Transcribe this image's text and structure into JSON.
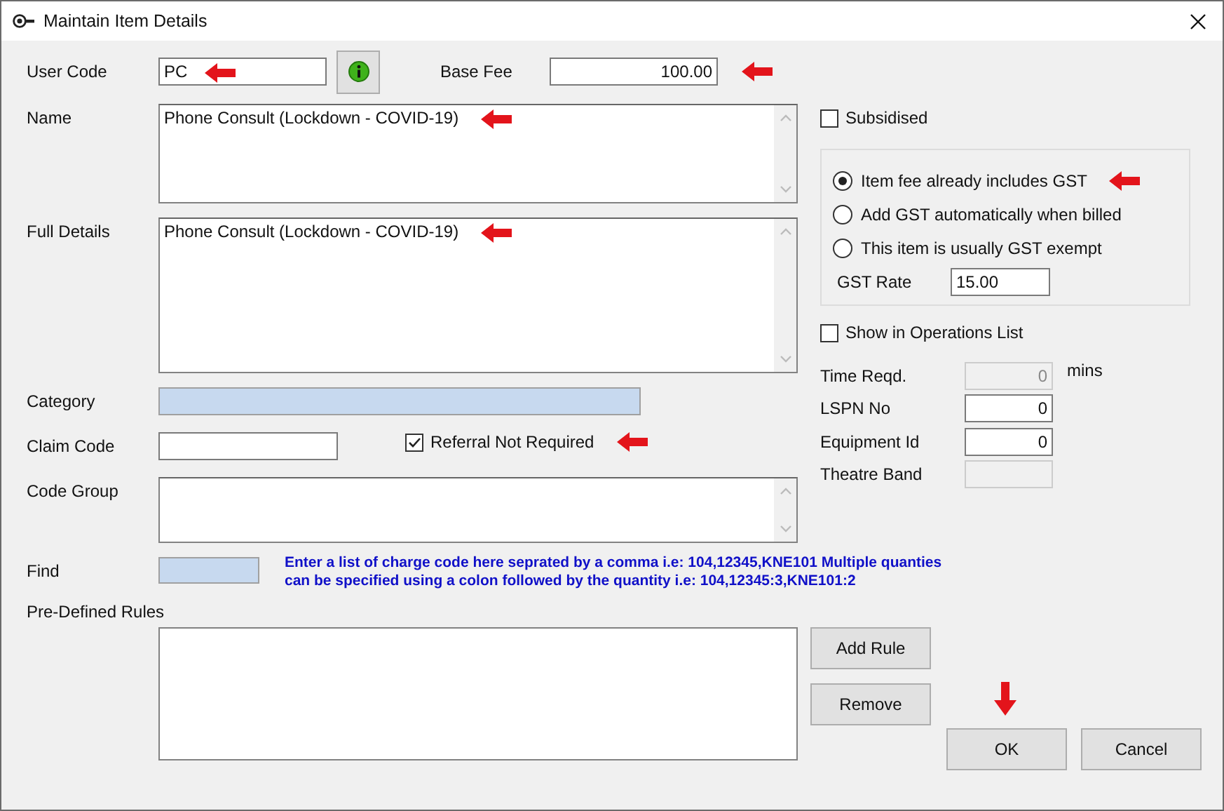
{
  "window": {
    "title": "Maintain Item Details"
  },
  "user_code": {
    "label": "User Code",
    "value": "PC"
  },
  "base_fee": {
    "label": "Base Fee",
    "value": "100.00"
  },
  "name": {
    "label": "Name",
    "value": "Phone Consult (Lockdown - COVID-19)"
  },
  "full_details": {
    "label": "Full Details",
    "value": "Phone Consult (Lockdown - COVID-19)"
  },
  "category": {
    "label": "Category"
  },
  "claim_code": {
    "label": "Claim Code"
  },
  "referral": {
    "label": "Referral Not Required",
    "checked": true
  },
  "code_group": {
    "label": "Code Group"
  },
  "find": {
    "label": "Find",
    "hint": "Enter a list of charge code here seprated by a comma i.e: 104,12345,KNE101 Multiple quanties can be specified using a colon followed by the quantity i.e: 104,12345:3,KNE101:2"
  },
  "rules": {
    "label": "Pre-Defined Rules"
  },
  "buttons": {
    "add_rule": "Add Rule",
    "remove": "Remove",
    "ok": "OK",
    "cancel": "Cancel"
  },
  "subsidised": {
    "label": "Subsidised",
    "checked": false
  },
  "gst_options": [
    {
      "label": "Item fee already includes GST",
      "selected": true
    },
    {
      "label": "Add GST automatically when billed",
      "selected": false
    },
    {
      "label": "This item is usually GST exempt",
      "selected": false
    }
  ],
  "gst_rate": {
    "label": "GST Rate",
    "value": "15.00"
  },
  "show_ops": {
    "label": "Show in Operations List",
    "checked": false
  },
  "fields": [
    {
      "label": "Time Reqd.",
      "value": "0",
      "disabled": true,
      "unit": "mins"
    },
    {
      "label": "LSPN No",
      "value": "0",
      "disabled": false
    },
    {
      "label": "Equipment Id",
      "value": "0",
      "disabled": false
    },
    {
      "label": "Theatre Band",
      "disabled": true
    }
  ]
}
